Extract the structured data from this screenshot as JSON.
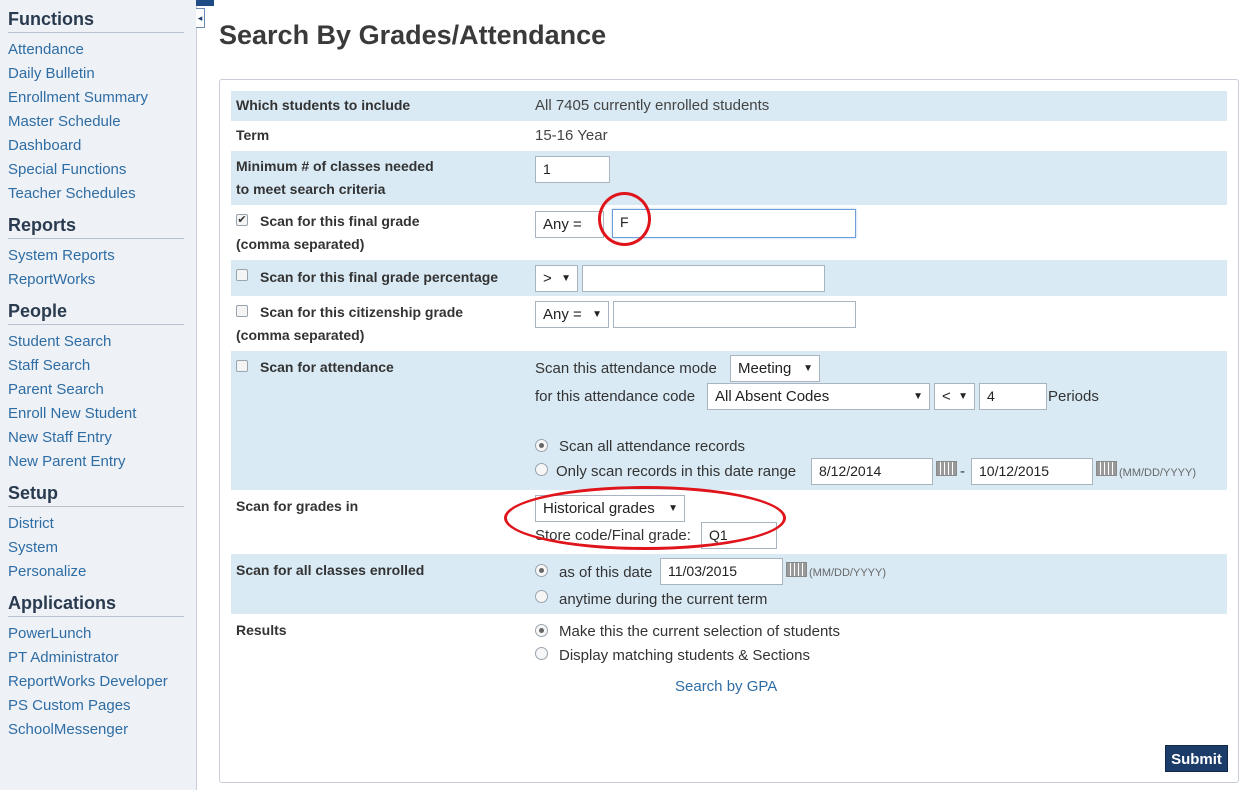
{
  "sidebar": {
    "sections": [
      {
        "heading": "Functions",
        "items": [
          "Attendance",
          "Daily Bulletin",
          "Enrollment Summary",
          "Master Schedule",
          "Dashboard",
          "Special Functions",
          "Teacher Schedules"
        ]
      },
      {
        "heading": "Reports",
        "items": [
          "System Reports",
          "ReportWorks"
        ]
      },
      {
        "heading": "People",
        "items": [
          "Student Search",
          "Staff Search",
          "Parent Search",
          "Enroll New Student",
          "New Staff Entry",
          "New Parent Entry"
        ]
      },
      {
        "heading": "Setup",
        "items": [
          "District",
          "System",
          "Personalize"
        ]
      },
      {
        "heading": "Applications",
        "items": [
          "PowerLunch",
          "PT Administrator",
          "ReportWorks Developer",
          "PS Custom Pages",
          "SchoolMessenger"
        ]
      }
    ],
    "collapse_glyph": "◂"
  },
  "page": {
    "title": "Search By Grades/Attendance"
  },
  "form": {
    "include": {
      "label": "Which students to include",
      "value": "All 7405 currently enrolled students"
    },
    "term": {
      "label": "Term",
      "value": "15-16 Year"
    },
    "min_classes": {
      "label_line1": "Minimum # of classes needed",
      "label_line2": "to meet search criteria",
      "value": "1"
    },
    "final_grade": {
      "checked": true,
      "check_glyph": "✔",
      "label_line1": "Scan for this final grade",
      "label_line2": "(comma separated)",
      "operator": "Any =",
      "value": "F"
    },
    "final_pct": {
      "checked": false,
      "label": "Scan for this final grade percentage",
      "operator": ">",
      "value": ""
    },
    "citizenship": {
      "checked": false,
      "label_line1": "Scan for this citizenship grade",
      "label_line2": "(comma separated)",
      "operator": "Any =",
      "value": ""
    },
    "attendance": {
      "checked": false,
      "label": "Scan for attendance",
      "mode_label": "Scan this attendance mode",
      "mode_value": "Meeting",
      "code_label": "for this attendance code",
      "code_value": "All Absent Codes",
      "comparator": "<",
      "count": "4",
      "periods_label": "Periods",
      "all_records_label": "Scan all attendance records",
      "range_label": "Only scan records in this date range",
      "date_from": "8/12/2014",
      "date_sep": "-",
      "date_to": "10/12/2015",
      "date_format": "(MM/DD/YYYY)"
    },
    "grades_in": {
      "label": "Scan for grades in",
      "value": "Historical grades",
      "store_code_label": "Store code/Final grade:",
      "store_code_value": "Q1"
    },
    "all_classes": {
      "label": "Scan for all classes enrolled",
      "as_of_label": "as of this date",
      "as_of_value": "11/03/2015",
      "date_format": "(MM/DD/YYYY)",
      "anytime_label": "anytime during the current term"
    },
    "results": {
      "label": "Results",
      "option1": "Make this the current selection of students",
      "option2": "Display matching students & Sections"
    },
    "gpa_link": "Search by GPA",
    "submit_label": "Submit"
  },
  "colors": {
    "accent": "#2e6da4",
    "row_shade": "#d9eaf4",
    "submit_bg": "#1c3d6a",
    "annotation": "#e0141b"
  },
  "arrow_glyph": "▼"
}
